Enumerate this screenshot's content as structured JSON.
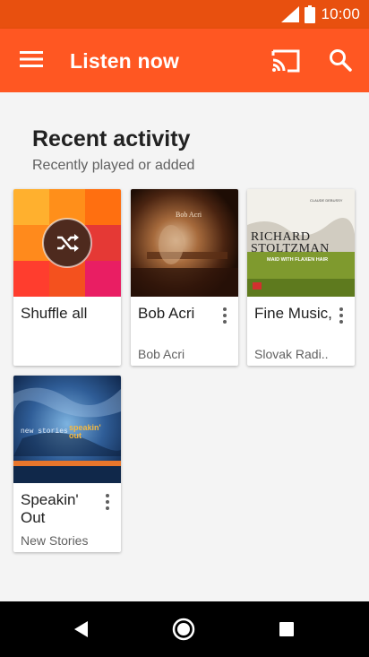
{
  "status_bar": {
    "time": "10:00"
  },
  "app_bar": {
    "title": "Listen now"
  },
  "recent": {
    "title": "Recent activity",
    "subtitle": "Recently played or added"
  },
  "cards": [
    {
      "title": "Shuffle all",
      "subtitle": ""
    },
    {
      "title": "Bob Acri",
      "subtitle": "Bob Acri",
      "art_text": "Bob Acri"
    },
    {
      "title": "Fine Music,",
      "subtitle": "Slovak Radi..",
      "art_line1": "RICHARD",
      "art_line2": "STOLTZMAN",
      "art_line3": "MAID WITH FLAXEN HAIR",
      "art_small": "CLAUDE DEBUSSY"
    },
    {
      "title": "Speakin' Out",
      "subtitle": "New Stories",
      "art_text1": "new stories",
      "art_text2": "speakin' out"
    }
  ],
  "colors": {
    "status": "#e8500f",
    "app_bar": "#ff5722"
  }
}
